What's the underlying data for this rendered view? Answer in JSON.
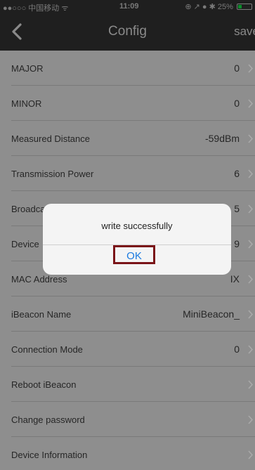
{
  "status_bar": {
    "carrier": "●●○○○ 中国移动 ᯤ",
    "time": "11:09",
    "right_icons": "⊕ ↗ ● ✱ 25%",
    "battery_level": 0.25,
    "battery_color": "#0a8f2a"
  },
  "nav": {
    "title": "Config",
    "save_label": "save",
    "back_icon": "chevron-left-icon"
  },
  "rows": [
    {
      "label": "MAJOR",
      "value": "0"
    },
    {
      "label": "MINOR",
      "value": "0"
    },
    {
      "label": "Measured Distance",
      "value": "-59dBm"
    },
    {
      "label": "Transmission Power",
      "value": "6"
    },
    {
      "label": "Broadca",
      "value": "5"
    },
    {
      "label": "Device",
      "value": "9"
    },
    {
      "label": "MAC Address",
      "value": "IX"
    },
    {
      "label": "iBeacon Name",
      "value": "MiniBeacon_"
    },
    {
      "label": "Connection Mode",
      "value": "0"
    },
    {
      "label": "Reboot iBeacon",
      "value": ""
    },
    {
      "label": "Change password",
      "value": ""
    },
    {
      "label": "Device Information",
      "value": ""
    }
  ],
  "alert": {
    "message": "write successfully",
    "ok_label": "OK",
    "highlight_color": "#7a1418"
  },
  "colors": {
    "overlay_bg": "#8e8e8e",
    "bar_bg": "#1f1f1f",
    "ok_text": "#1a7ae0"
  }
}
